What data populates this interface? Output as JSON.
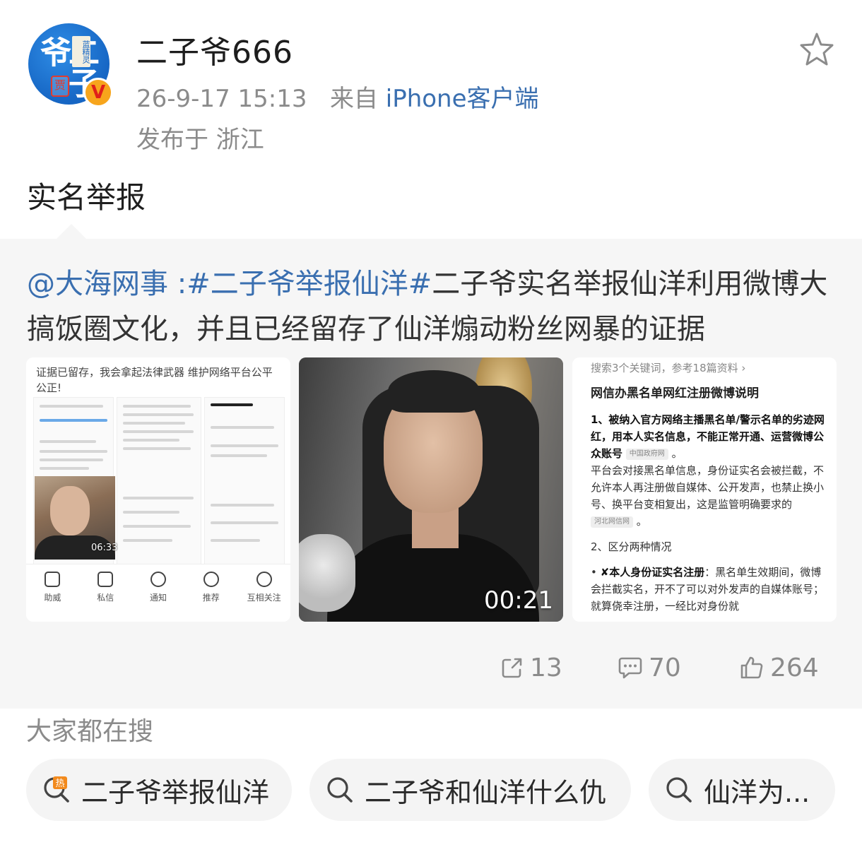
{
  "author": {
    "name": "二子爷666",
    "time": "26-9-17 15:13",
    "source_prefix": "来自",
    "client": "iPhone客户端",
    "location": "发布于 浙江",
    "avatar_text": "二子爷",
    "avatar_seal": "蓝精灵"
  },
  "post": {
    "text": "实名举报"
  },
  "repost": {
    "mention": "@大海网事",
    "topic": ":#二子爷举报仙洋#",
    "text": "二子爷实名举报仙洋利用微博大搞饭圈文化，并且已经留存了仙洋煽动粉丝网暴的证据",
    "thumbs": [
      {
        "caption": "证据已留存，我会拿起法律武器 维护网络平台公平公正!",
        "duration": "06:33",
        "tabs": [
          "助威",
          "私信",
          "通知",
          "推荐",
          "互相关注"
        ]
      },
      {
        "duration": "00:21"
      },
      {
        "hint": "搜索3个关键词，参考18篇资料 ›",
        "title": "网信办黑名单网红注册微博说明",
        "p1_bold": "1、被纳入官方网络主播黑名单/警示名单的劣迹网红，用本人实名信息，不能正常开通、运营微博公众账号",
        "tag1": "中国政府网",
        "p2": "平台会对接黑名单信息，身份证实名会被拦截，不允许本人再注册做自媒体、公开发声，也禁止换小号、换平台变相复出，这是监管明确要求的",
        "tag2": "河北网信网",
        "p3": "2、区分两种情况",
        "p4_bold": "✘本人身份证实名注册",
        "p4": "：黑名单生效期间，微博会拦截实名，开不了可以对外发声的自媒体账号；就算侥幸注册，一经比对身份就"
      }
    ],
    "counts": {
      "share": "13",
      "comment": "70",
      "like": "264"
    }
  },
  "trending": {
    "title": "大家都在搜",
    "items": [
      "二子爷举报仙洋",
      "二子爷和仙洋什么仇",
      "仙洋为..."
    ]
  },
  "colors": {
    "link": "#3a6fb0",
    "meta": "#8b8b8b",
    "panel": "#f6f6f6",
    "hot": "#f28a1d"
  }
}
